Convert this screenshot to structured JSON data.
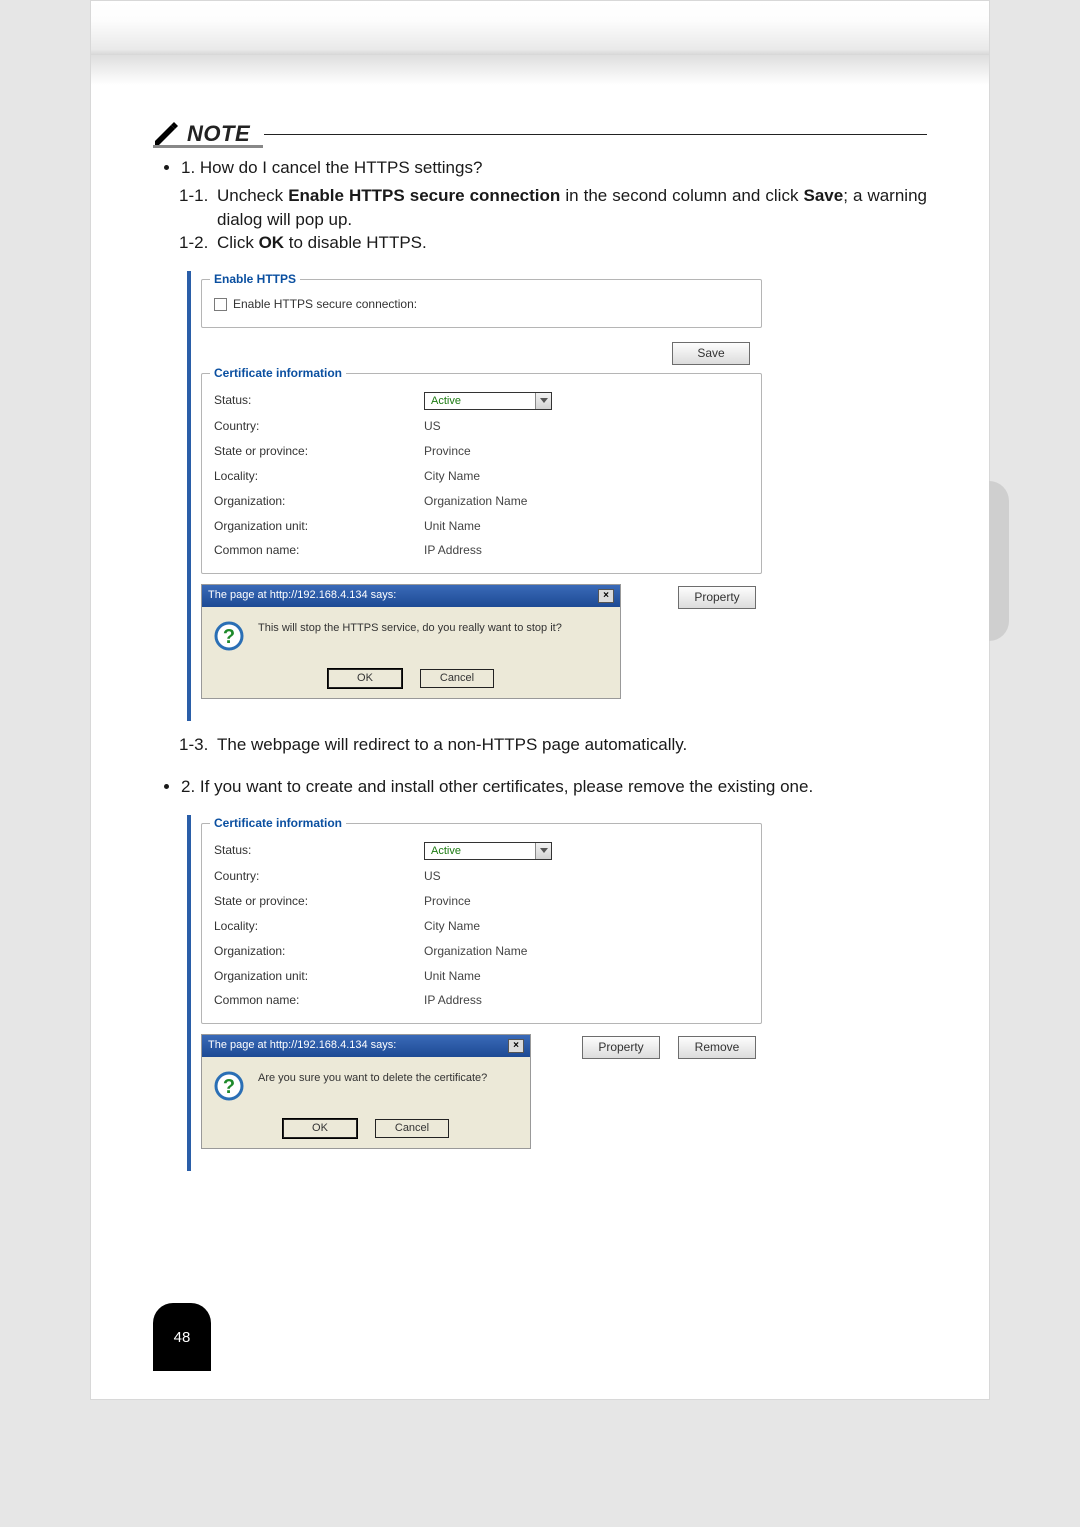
{
  "page_number": "48",
  "note_label": "NOTE",
  "bullets": {
    "b1": "1. How do I cancel the HTTPS settings?",
    "b1_1_pre": "Uncheck ",
    "b1_1_bold": "Enable HTTPS secure connection",
    "b1_1_mid": " in the second column and click ",
    "b1_1_bold2": "Save",
    "b1_1_post": "; a warning dialog will pop up.",
    "b1_2_pre": "Click ",
    "b1_2_bold": "OK",
    "b1_2_post": " to disable HTTPS.",
    "b1_3": "The webpage will redirect to a non-HTTPS page automatically.",
    "b2": "2. If you want to create and install other certificates, please remove the existing one."
  },
  "panel": {
    "enable_legend": "Enable HTTPS",
    "enable_checkbox_label": "Enable HTTPS secure connection:",
    "save": "Save",
    "cert_legend": "Certificate information",
    "status_k": "Status:",
    "status_v": "Active",
    "country_k": "Country:",
    "country_v": "US",
    "state_k": "State or province:",
    "state_v": "Province",
    "locality_k": "Locality:",
    "locality_v": "City Name",
    "org_k": "Organization:",
    "org_v": "Organization Name",
    "orgu_k": "Organization unit:",
    "orgu_v": "Unit Name",
    "cn_k": "Common name:",
    "cn_v": "IP Address",
    "property": "Property",
    "remove": "Remove"
  },
  "dialog": {
    "title": "The page at http://192.168.4.134 says:",
    "msg_stop": "This will stop the HTTPS service, do you really want to stop it?",
    "msg_delete": "Are you sure you want to delete the certificate?",
    "ok": "OK",
    "cancel": "Cancel",
    "close_x": "×"
  }
}
